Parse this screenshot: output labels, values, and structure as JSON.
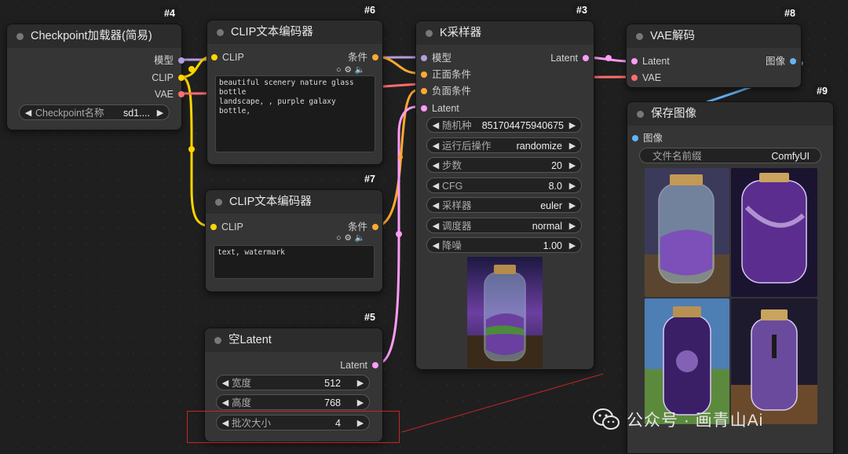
{
  "colors": {
    "model": "#b39ddb",
    "clip": "#ffd500",
    "vae": "#ff6e6e",
    "conditioning": "#ffa931",
    "latent": "#ff9cf9",
    "image": "#64b5f6",
    "annotation": "#c0262b"
  },
  "node4": {
    "id": "#4",
    "title": "Checkpoint加载器(简易)",
    "outputs": [
      "模型",
      "CLIP",
      "VAE"
    ],
    "ckpt_label": "Checkpoint名称",
    "ckpt_value": "sd1...."
  },
  "node6": {
    "id": "#6",
    "title": "CLIP文本编码器",
    "input": "CLIP",
    "output": "条件",
    "text": "beautiful scenery nature glass bottle\nlandscape, , purple galaxy bottle,"
  },
  "node7": {
    "id": "#7",
    "title": "CLIP文本编码器",
    "input": "CLIP",
    "output": "条件",
    "text": "text, watermark"
  },
  "node5": {
    "id": "#5",
    "title": "空Latent",
    "output": "Latent",
    "widgets": [
      {
        "label": "宽度",
        "value": "512"
      },
      {
        "label": "高度",
        "value": "768"
      },
      {
        "label": "批次大小",
        "value": "4"
      }
    ]
  },
  "node3": {
    "id": "#3",
    "title": "K采样器",
    "inputs": [
      "模型",
      "正面条件",
      "负面条件",
      "Latent"
    ],
    "output": "Latent",
    "widgets": [
      {
        "label": "随机种",
        "value": "851704475940675"
      },
      {
        "label": "运行后操作",
        "value": "randomize"
      },
      {
        "label": "步数",
        "value": "20"
      },
      {
        "label": "CFG",
        "value": "8.0"
      },
      {
        "label": "采样器",
        "value": "euler"
      },
      {
        "label": "调度器",
        "value": "normal"
      },
      {
        "label": "降噪",
        "value": "1.00"
      }
    ]
  },
  "node8": {
    "id": "#8",
    "title": "VAE解码",
    "inputs": [
      "Latent",
      "VAE"
    ],
    "output": "图像"
  },
  "node9": {
    "id": "#9",
    "title": "保存图像",
    "input": "图像",
    "prefix_label": "文件名前缀",
    "prefix_value": "ComfyUI"
  },
  "watermark": {
    "text": "公众号 · 画青山Ai"
  }
}
